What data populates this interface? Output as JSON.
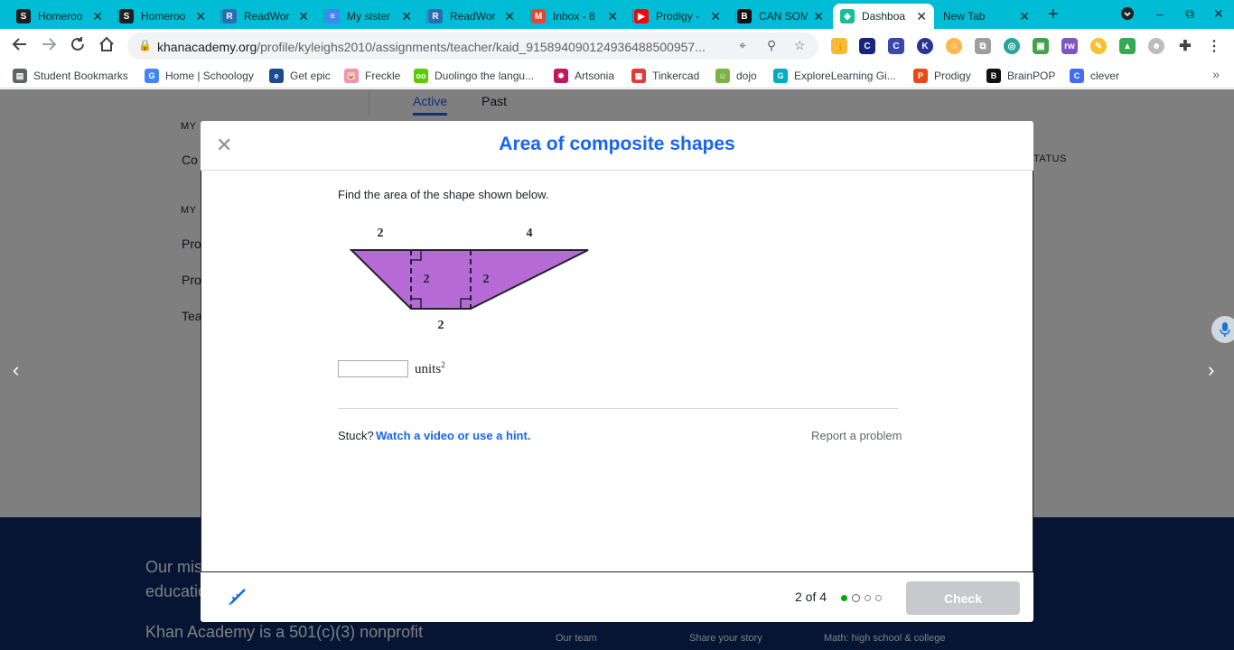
{
  "tabs": [
    {
      "title": "Homeroo",
      "favicon": "S",
      "color": "#1f1f1f",
      "fg": "#fff"
    },
    {
      "title": "Homeroo",
      "favicon": "S",
      "color": "#1f1f1f",
      "fg": "#fff"
    },
    {
      "title": "ReadWor",
      "favicon": "R",
      "color": "#2d6cb3",
      "fg": "#fff"
    },
    {
      "title": "My sister",
      "favicon": "≡",
      "color": "#4285f4",
      "fg": "#fff"
    },
    {
      "title": "ReadWor",
      "favicon": "R",
      "color": "#2d6cb3",
      "fg": "#fff"
    },
    {
      "title": "Inbox - 8",
      "favicon": "M",
      "color": "#ea4335",
      "fg": "#fff"
    },
    {
      "title": "Prodigy -",
      "favicon": "▶",
      "color": "#ff0000",
      "fg": "#fff"
    },
    {
      "title": "CAN SOM",
      "favicon": "B",
      "color": "#111",
      "fg": "#fff"
    },
    {
      "title": "Dashboa",
      "favicon": "◈",
      "color": "#14bf96",
      "fg": "#fff"
    },
    {
      "title": "New Tab",
      "favicon": "",
      "color": "transparent",
      "fg": "#fff"
    }
  ],
  "toolbar": {
    "url_host": "khanacademy.org",
    "url_path": "/profile/kyleighs2010/assignments/teacher/kaid_91589409012493648850095​7..."
  },
  "bookmarks": [
    {
      "label": "Student Bookmarks",
      "icon": "▤",
      "color": "#5f6368"
    },
    {
      "label": "Home | Schoology",
      "icon": "G",
      "color": "#4285f4"
    },
    {
      "label": "Get epic",
      "icon": "e",
      "color": "#1a4b8c"
    },
    {
      "label": "Freckle",
      "icon": "🐷",
      "color": "#f48fb1"
    },
    {
      "label": "Duolingo the langu...",
      "icon": "oo",
      "color": "#58cc02"
    },
    {
      "label": "Artsonia",
      "icon": "✸",
      "color": "#c2185b"
    },
    {
      "label": "Tinkercad",
      "icon": "▦",
      "color": "#e53935"
    },
    {
      "label": "dojo",
      "icon": "☺",
      "color": "#7cb342"
    },
    {
      "label": "ExploreLearning Gi...",
      "icon": "G",
      "color": "#00acc1"
    },
    {
      "label": "Prodigy",
      "icon": "P",
      "color": "#e64a19"
    },
    {
      "label": "BrainPOP",
      "icon": "B",
      "color": "#111"
    },
    {
      "label": "clever",
      "icon": "C",
      "color": "#436cf2"
    }
  ],
  "background": {
    "tab_active": "Active",
    "tab_past": "Past",
    "my_label_1": "MY",
    "co_text": "Co",
    "my_label_2": "MY",
    "pro_1": "Pro",
    "pro_2": "Pro",
    "tea": "Tea",
    "status_col": "TATUS",
    "footer_line_1": "Our mis",
    "footer_line_2": "educatio",
    "footer_line_3": "Khan Academy is a 501(c)(3) nonprofit",
    "footer_links": [
      "Our team",
      "Share your story",
      "Math: high school & college"
    ]
  },
  "modal": {
    "title": "Area of composite shapes",
    "prompt": "Find the area of the shape shown below.",
    "figure": {
      "top_left_label": "2",
      "top_right_label": "4",
      "middle_height_left": "2",
      "middle_height_right": "2",
      "bottom_label": "2",
      "fill_color": "#b56ad6"
    },
    "answer_value": "",
    "units_text": "units",
    "units_exp": "2",
    "stuck_label": "Stuck?",
    "hint_link": "Watch a video or use a hint.",
    "report_link": "Report a problem",
    "progress_text": "2 of 4",
    "progress": {
      "current": 2,
      "total": 4,
      "completed": 1
    },
    "check_label": "Check"
  },
  "colors": {
    "accent": "#1865f2",
    "chrome_tabs": "#00bcd4",
    "footer": "#0a2a66"
  }
}
